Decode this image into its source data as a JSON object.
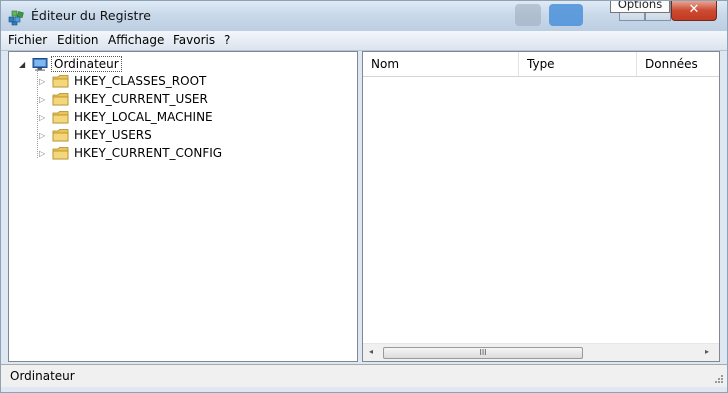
{
  "window": {
    "title": "Éditeur du Registre",
    "tooltip": "Options",
    "close_glyph": "✕"
  },
  "menu": [
    "Fichier",
    "Edition",
    "Affichage",
    "Favoris",
    "?"
  ],
  "tree": {
    "root": "Ordinateur",
    "root_expander": "◢",
    "expander": "▷",
    "keys": [
      "HKEY_CLASSES_ROOT",
      "HKEY_CURRENT_USER",
      "HKEY_LOCAL_MACHINE",
      "HKEY_USERS",
      "HKEY_CURRENT_CONFIG"
    ]
  },
  "list": {
    "columns": [
      "Nom",
      "Type",
      "Données"
    ],
    "scroll_left": "◂",
    "scroll_right": "▸",
    "thumb_grip": "III"
  },
  "status": {
    "text": "Ordinateur"
  },
  "icons": {
    "app": "registry-editor-icon",
    "computer": "computer-icon",
    "folder": "folder-icon"
  },
  "colors": {
    "folder": "#e8c65a",
    "close": "#cc4b32"
  }
}
